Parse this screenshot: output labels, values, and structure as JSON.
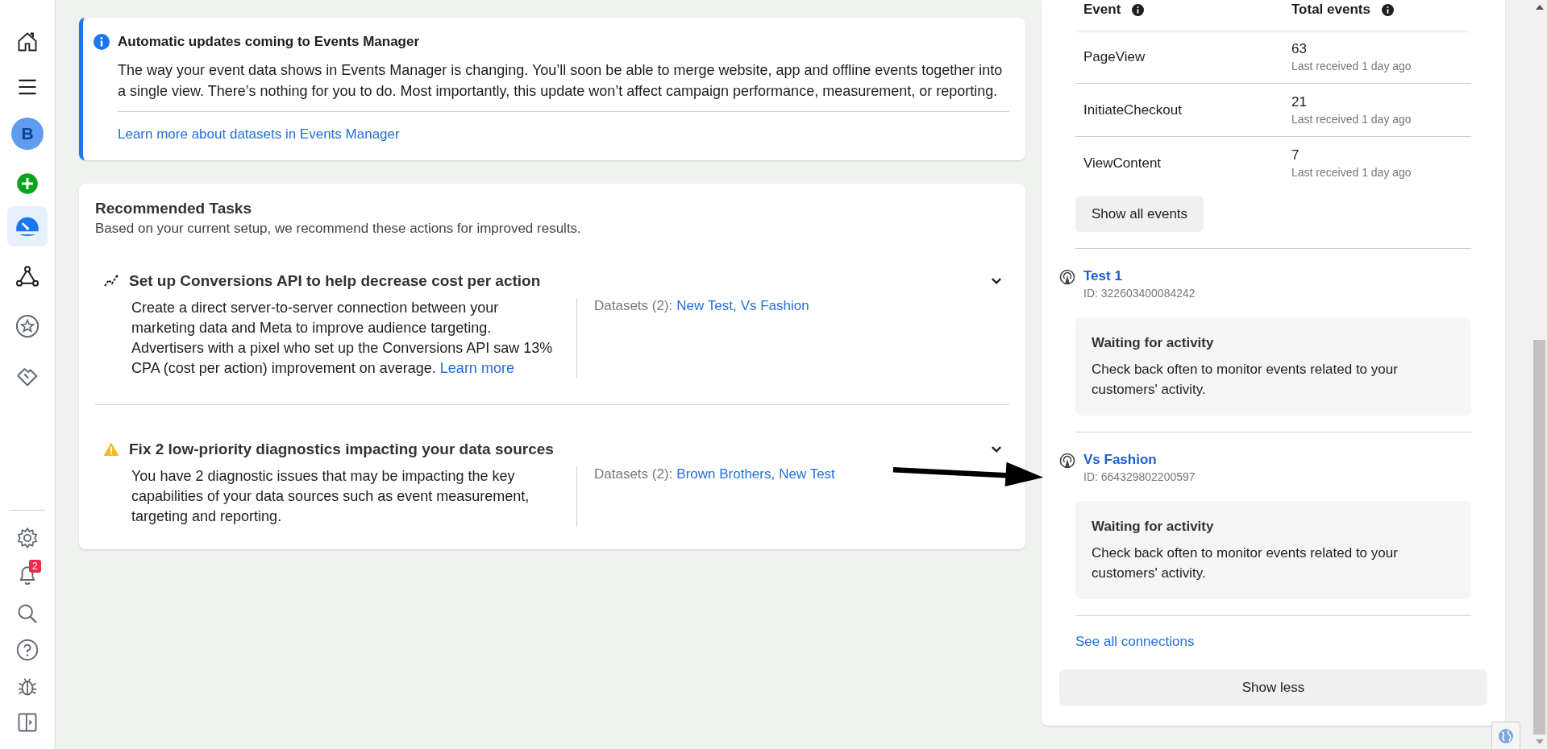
{
  "sidebar": {
    "avatar": "B",
    "nav": [
      {
        "selected": true
      },
      {
        "selected": false
      },
      {
        "selected": false
      },
      {
        "selected": false
      }
    ],
    "notification_badge": "2"
  },
  "notice": {
    "title": "Automatic updates coming to Events Manager",
    "body": "The way your event data shows in Events Manager is changing. You’ll soon be able to merge website, app and offline events together into a single view. There’s nothing for you to do. Most importantly, this update won’t affect campaign performance, measurement, or reporting.",
    "link": "Learn more about datasets in Events Manager"
  },
  "tasks": {
    "title": "Recommended Tasks",
    "subtitle": "Based on your current setup, we recommend these actions for improved results.",
    "items": [
      {
        "kind": "trend",
        "title": "Set up Conversions API to help decrease cost per action",
        "body": "Create a direct server-to-server connection between your marketing data and Meta to improve audience targeting. Advertisers with a pixel who set up the Conversions API saw 13% CPA (cost per action) improvement on average.",
        "link": "Learn more",
        "datasets_label": "Datasets (2):",
        "datasets": [
          "New Test,",
          "Vs Fashion"
        ]
      },
      {
        "kind": "warning",
        "title": "Fix 2 low-priority diagnostics impacting your data sources",
        "body": "You have 2 diagnostic issues that may be impacting the key capabilities of your data sources such as event measurement, targeting and reporting.",
        "datasets_label": "Datasets (2):",
        "datasets": [
          "Brown Brothers,",
          "New Test"
        ]
      }
    ]
  },
  "events_table": {
    "columns": [
      "Event",
      "Total events"
    ],
    "rows": [
      {
        "event": "PageView",
        "total": "63",
        "last_received": "Last received 1 day ago"
      },
      {
        "event": "InitiateCheckout",
        "total": "21",
        "last_received": "Last received 1 day ago"
      },
      {
        "event": "ViewContent",
        "total": "7",
        "last_received": "Last received 1 day ago"
      }
    ]
  },
  "show_all_button": "Show all events",
  "connections": [
    {
      "name": "Test 1",
      "id": "ID: 322603400084242",
      "status_title": "Waiting for activity",
      "status_body": "Check back often to monitor events related to your customers' activity."
    },
    {
      "name": "Vs Fashion",
      "id": "ID: 664329802200597",
      "status_title": "Waiting for activity",
      "status_body": "Check back often to monitor events related to your customers' activity."
    }
  ],
  "see_all_link": "See all connections",
  "show_less_button": "Show less"
}
